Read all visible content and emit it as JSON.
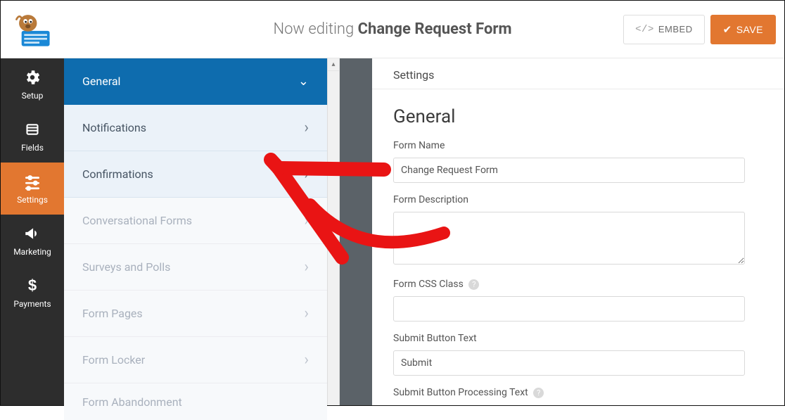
{
  "header": {
    "prefix": "Now editing ",
    "form_title": "Change Request Form",
    "embed_label": "EMBED",
    "save_label": "SAVE"
  },
  "iconbar": {
    "items": [
      {
        "id": "setup",
        "label": "Setup"
      },
      {
        "id": "fields",
        "label": "Fields"
      },
      {
        "id": "settings",
        "label": "Settings"
      },
      {
        "id": "marketing",
        "label": "Marketing"
      },
      {
        "id": "payments",
        "label": "Payments"
      }
    ],
    "active": "settings"
  },
  "subnav": {
    "items": [
      {
        "label": "General",
        "state": "active"
      },
      {
        "label": "Notifications",
        "state": ""
      },
      {
        "label": "Confirmations",
        "state": ""
      },
      {
        "label": "Conversational Forms",
        "state": "group2"
      },
      {
        "label": "Surveys and Polls",
        "state": "group2"
      },
      {
        "label": "Form Pages",
        "state": "group2"
      },
      {
        "label": "Form Locker",
        "state": "group2"
      },
      {
        "label": "Form Abandonment",
        "state": "group2"
      }
    ]
  },
  "panel": {
    "breadcrumb": "Settings",
    "section_title": "General",
    "form_name_label": "Form Name",
    "form_name_value": "Change Request Form",
    "form_desc_label": "Form Description",
    "form_desc_value": "",
    "form_css_label": "Form CSS Class",
    "form_css_value": "",
    "submit_text_label": "Submit Button Text",
    "submit_text_value": "Submit",
    "submit_processing_label": "Submit Button Processing Text"
  }
}
